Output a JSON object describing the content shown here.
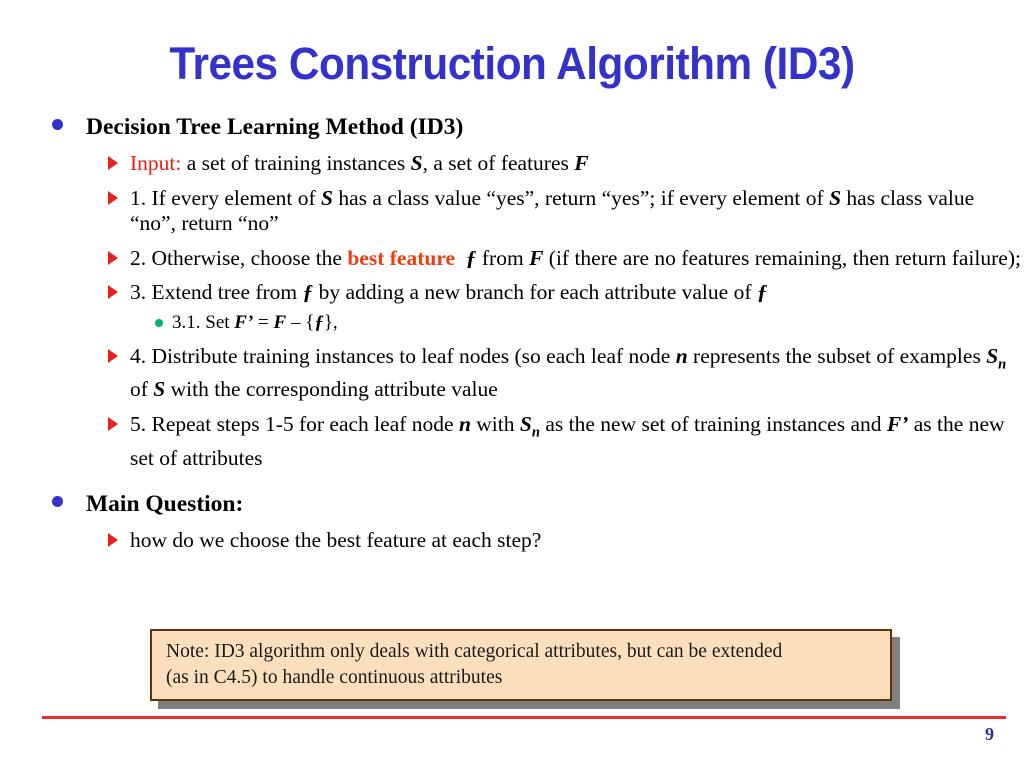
{
  "slide": {
    "title": "Trees Construction Algorithm (ID3)",
    "page_number": "9"
  },
  "colors": {
    "title_blue": "#3333CC",
    "bullet_level1": "#3333CC",
    "bullet_level2": "#E8221B",
    "bullet_level3": "#00B377",
    "accent_red": "#EE1C11",
    "highlight_orange": "#F03C10",
    "note_fill": "#FBDFBD",
    "note_border": "#63310C",
    "note_shadow": "#808080",
    "footer_rule": "#F42A2A",
    "page_number": "#2A2A9E"
  },
  "content": {
    "heading_method": "Decision Tree Learning Method (ID3)",
    "input_label": "Input:",
    "input_rest_1": " a set of training instances ",
    "input_var_s": "S",
    "input_rest_2": ", a set of features ",
    "input_var_f": "F",
    "step1_a": "1. If every element of ",
    "step1_s1": "S",
    "step1_b": " has a class value “yes”, return “yes”; if every element of ",
    "step1_s2": "S",
    "step1_c": " has class value “no”, return “no”",
    "step2_a": "2. Otherwise, choose the ",
    "step2_highlight": "best feature",
    "step2_f1": "ƒ",
    "step2_b": " from ",
    "step2_F": "F",
    "step2_c": " (if there are no features remaining, then return failure);",
    "step3_a": "3. Extend tree from ",
    "step3_f1": "ƒ",
    "step3_b": " by adding a new branch for each attribute value of ",
    "step3_f2": "ƒ",
    "step31_a": "3.1. Set ",
    "step31_Fprime": "F’",
    "step31_eq": " = ",
    "step31_F": "F",
    "step31_minus": " – {",
    "step31_f": "ƒ",
    "step31_end": "},",
    "step4_a": "4. Distribute training instances to leaf nodes (so each leaf node ",
    "step4_n": "n",
    "step4_b": " represents the subset of examples ",
    "step4_S_base": "S",
    "step4_S_sub": "n",
    "step4_c": " of ",
    "step4_S2": "S",
    "step4_d": " with the corresponding attribute value",
    "step5_a": "5. Repeat steps 1-5 for each leaf node ",
    "step5_n": "n",
    "step5_b": " with ",
    "step5_S_base": "S",
    "step5_S_sub": "n",
    "step5_c": " as the new set of training instances and ",
    "step5_Fprime": "F’",
    "step5_d": " as the new set of attributes",
    "heading_question": "Main Question:",
    "question_text": "how do we choose the best feature at each step?"
  },
  "note": {
    "line1": "Note: ID3 algorithm only deals with categorical attributes, but can be extended",
    "line2": "(as in C4.5) to handle continuous attributes"
  }
}
